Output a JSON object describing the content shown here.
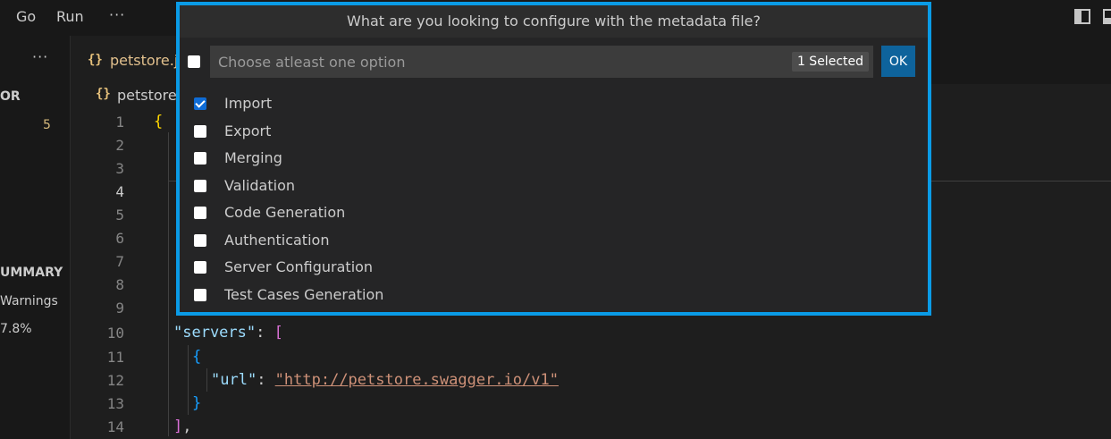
{
  "menubar": {
    "items": [
      "Go",
      "Run"
    ],
    "more": "···"
  },
  "sidebar": {
    "more": "···",
    "section_title": "OR",
    "badge": "5",
    "summary_title": "UMMARY",
    "warnings": "Warnings",
    "percent": "7.8%"
  },
  "tab": {
    "icon": "{}",
    "name": "petstore.j"
  },
  "breadcrumb": {
    "icon": "{}",
    "name": "petstore"
  },
  "editor": {
    "line_numbers": [
      "1",
      "2",
      "3",
      "4",
      "5",
      "6",
      "7",
      "8",
      "9",
      "10",
      "11",
      "12",
      "13",
      "14"
    ],
    "active_line": "4",
    "code": {
      "l1": "{",
      "l10_key": "\"servers\"",
      "l10_punct": ": ",
      "l10_bracket": "[",
      "l11": "{",
      "l12_key": "\"url\"",
      "l12_punct": ": ",
      "l12_value": "\"http://petstore.swagger.io/v1\"",
      "l13": "}",
      "l14_bracket": "]",
      "l14_punct": ","
    }
  },
  "quick_pick": {
    "title": "What are you looking to configure with the metadata file?",
    "input_placeholder": "Choose atleast one option",
    "selected_count": "1 Selected",
    "ok_label": "OK",
    "options": [
      {
        "label": "Import",
        "checked": true
      },
      {
        "label": "Export",
        "checked": false
      },
      {
        "label": "Merging",
        "checked": false
      },
      {
        "label": "Validation",
        "checked": false
      },
      {
        "label": "Code Generation",
        "checked": false
      },
      {
        "label": "Authentication",
        "checked": false
      },
      {
        "label": "Server Configuration",
        "checked": false
      },
      {
        "label": "Test Cases Generation",
        "checked": false
      }
    ],
    "accent_color": "#0a9be6"
  }
}
